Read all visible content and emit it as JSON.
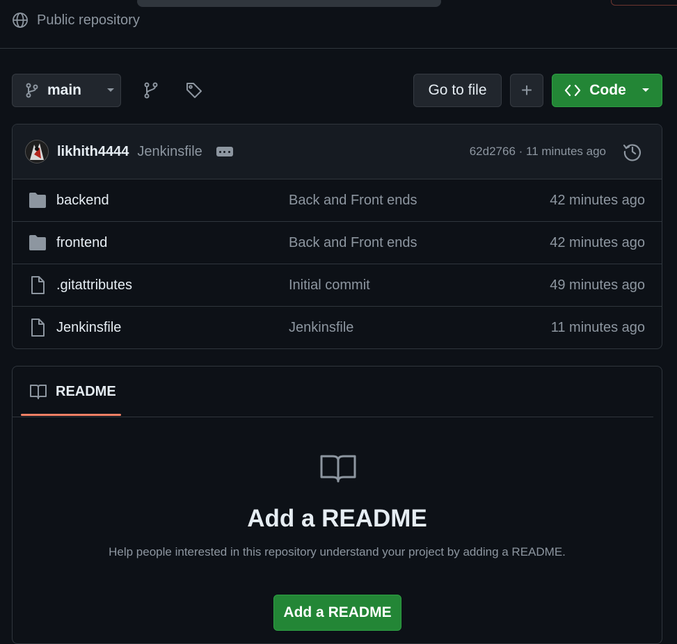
{
  "repo": {
    "visibility_label": "Public repository"
  },
  "toolbar": {
    "branch_name": "main",
    "goto_file_label": "Go to file",
    "add_label": "+",
    "code_label": "Code"
  },
  "latest_commit": {
    "author": "likhith4444",
    "message": "Jenkinsfile",
    "meta": "62d2766 · 11 minutes ago"
  },
  "files": [
    {
      "type": "folder",
      "name": "backend",
      "message": "Back and Front ends",
      "time": "42 minutes ago"
    },
    {
      "type": "folder",
      "name": "frontend",
      "message": "Back and Front ends",
      "time": "42 minutes ago"
    },
    {
      "type": "file",
      "name": ".gitattributes",
      "message": "Initial commit",
      "time": "49 minutes ago"
    },
    {
      "type": "file",
      "name": "Jenkinsfile",
      "message": "Jenkinsfile",
      "time": "11 minutes ago"
    }
  ],
  "readme": {
    "tab_label": "README",
    "title": "Add a README",
    "description": "Help people interested in this repository understand your project by adding a README.",
    "button_label": "Add a README"
  },
  "colors": {
    "background": "#0d1117",
    "accent_green": "#238636",
    "tab_underline": "#f78166"
  },
  "icons": [
    "globe-icon",
    "branch-icon",
    "branches-icon",
    "tag-icon",
    "code-icon",
    "history-icon",
    "folder-icon",
    "file-icon",
    "book-icon"
  ]
}
